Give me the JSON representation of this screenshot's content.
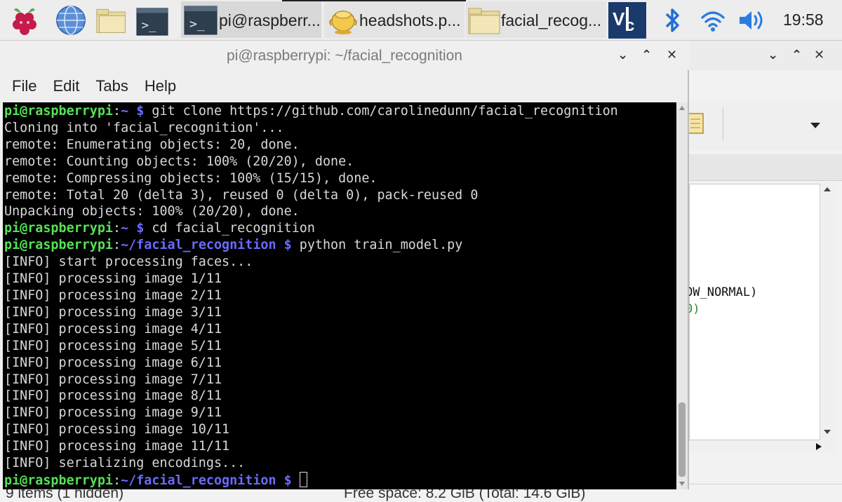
{
  "taskbar": {
    "launchers": [
      {
        "name": "raspberry-menu-icon"
      },
      {
        "name": "web-browser-icon"
      },
      {
        "name": "file-manager-icon"
      },
      {
        "name": "terminal-icon"
      }
    ],
    "tasks": [
      {
        "label": "pi@raspberr...",
        "icon": "terminal-icon",
        "active": true
      },
      {
        "label": "headshots.p...",
        "icon": "image-viewer-icon",
        "active": false
      },
      {
        "label": "facial_recog...",
        "icon": "folder-icon",
        "active": false
      }
    ],
    "tray": [
      "vnc-icon",
      "bluetooth-icon",
      "wifi-icon",
      "volume-icon"
    ],
    "clock": "19:58"
  },
  "terminal": {
    "title": "pi@raspberrypi: ~/facial_recognition",
    "menu": [
      "File",
      "Edit",
      "Tabs",
      "Help"
    ],
    "lines": [
      {
        "type": "prompt",
        "user": "pi@raspberrypi",
        "path": "~",
        "cmd": "git clone https://github.com/carolinedunn/facial_recognition"
      },
      {
        "type": "out",
        "text": "Cloning into 'facial_recognition'..."
      },
      {
        "type": "out",
        "text": "remote: Enumerating objects: 20, done."
      },
      {
        "type": "out",
        "text": "remote: Counting objects: 100% (20/20), done."
      },
      {
        "type": "out",
        "text": "remote: Compressing objects: 100% (15/15), done."
      },
      {
        "type": "out",
        "text": "remote: Total 20 (delta 3), reused 0 (delta 0), pack-reused 0"
      },
      {
        "type": "out",
        "text": "Unpacking objects: 100% (20/20), done."
      },
      {
        "type": "prompt",
        "user": "pi@raspberrypi",
        "path": "~",
        "cmd": "cd facial_recognition"
      },
      {
        "type": "prompt",
        "user": "pi@raspberrypi",
        "path": "~/facial_recognition",
        "cmd": "python train_model.py"
      },
      {
        "type": "out",
        "text": "[INFO] start processing faces..."
      },
      {
        "type": "out",
        "text": "[INFO] processing image 1/11"
      },
      {
        "type": "out",
        "text": "[INFO] processing image 2/11"
      },
      {
        "type": "out",
        "text": "[INFO] processing image 3/11"
      },
      {
        "type": "out",
        "text": "[INFO] processing image 4/11"
      },
      {
        "type": "out",
        "text": "[INFO] processing image 5/11"
      },
      {
        "type": "out",
        "text": "[INFO] processing image 6/11"
      },
      {
        "type": "out",
        "text": "[INFO] processing image 7/11"
      },
      {
        "type": "out",
        "text": "[INFO] processing image 8/11"
      },
      {
        "type": "out",
        "text": "[INFO] processing image 9/11"
      },
      {
        "type": "out",
        "text": "[INFO] processing image 10/11"
      },
      {
        "type": "out",
        "text": "[INFO] processing image 11/11"
      },
      {
        "type": "out",
        "text": "[INFO] serializing encodings..."
      },
      {
        "type": "prompt",
        "user": "pi@raspberrypi",
        "path": "~/facial_recognition",
        "cmd": "",
        "cursor": true
      }
    ]
  },
  "background_window": {
    "code_line_1": "OW_NORMAL)",
    "code_line_2": "0)"
  },
  "statusbar": {
    "left": "9 items (1 hidden)",
    "right": "Free space: 8.2 GiB (Total: 14.6 GiB)"
  },
  "colors": {
    "prompt_user": "#55e155",
    "prompt_path": "#6a6aff",
    "terminal_bg": "#000000",
    "vnc_tile": "#1a3a6b",
    "bluetooth": "#1f6fd6"
  }
}
